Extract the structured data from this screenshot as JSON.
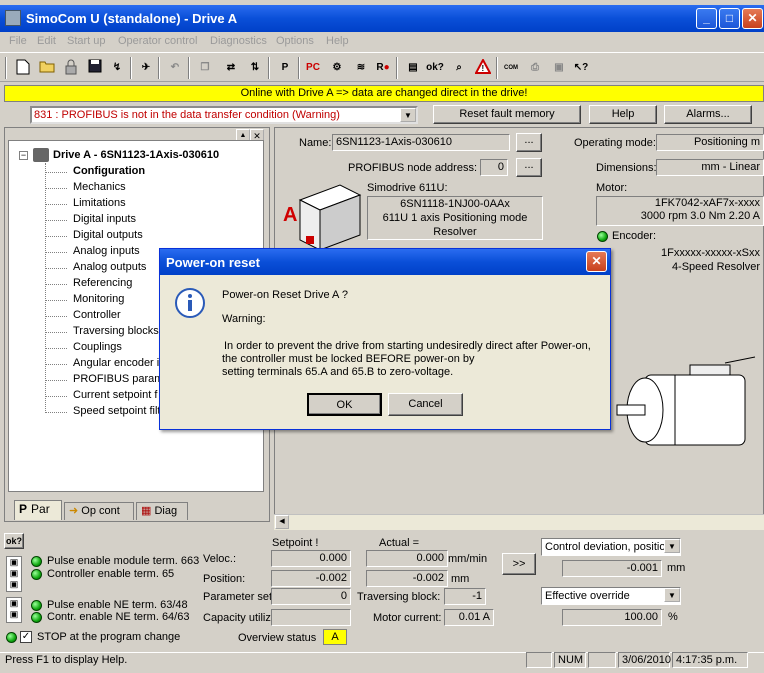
{
  "window": {
    "title": "SimoCom U (standalone) - Drive A",
    "min": "_",
    "max": "□",
    "close": "✕"
  },
  "menu": [
    "File",
    "Edit",
    "Start up",
    "Operator control",
    "Diagnostics",
    "Options",
    "Help"
  ],
  "toolbar": {
    "ok_label": "ok?",
    "pc_label": "PC",
    "p_label": "P",
    "r_label": "R",
    "com_label": "COM"
  },
  "banner": "Online with Drive A => data are changed direct in the drive!",
  "fault": {
    "selected": "831 : PROFIBUS is not in the data transfer condition (Warning)",
    "reset_button": "Reset fault memory",
    "help_button": "Help",
    "alarms_button": "Alarms..."
  },
  "tree": {
    "root": "Drive A - 6SN1123-1Axis-030610",
    "items": [
      "Configuration",
      "Mechanics",
      "Limitations",
      "Digital inputs",
      "Digital outputs",
      "Analog inputs",
      "Analog outputs",
      "Referencing",
      "Monitoring",
      "Controller",
      "Traversing blocks",
      "Couplings",
      "Angular encoder in",
      "PROFIBUS paramet",
      "Current setpoint f",
      "Speed setpoint filt"
    ],
    "selected_index": 0
  },
  "tabs": [
    {
      "label": "Par"
    },
    {
      "label": "Op cont"
    },
    {
      "label": "Diag"
    }
  ],
  "config": {
    "name_label": "Name:",
    "name_value": "6SN1123-1Axis-030610",
    "browse": "...",
    "profibus_label": "PROFIBUS node address:",
    "profibus_value": "0",
    "opmode_label": "Operating mode:",
    "opmode_value": "Positioning m",
    "dimensions_label": "Dimensions:",
    "dimensions_value": "mm - Linear",
    "simodrive_label": "Simodrive 611U:",
    "simodrive_lines": [
      "6SN1118-1NJ00-0AAx",
      "611U 1 axis Positioning mode",
      "Resolver"
    ],
    "drive_letter": "A",
    "motor_label": "Motor:",
    "motor_lines": [
      "1FK7042-xAF7x-xxxx",
      "3000 rpm  3.0 Nm  2.20 A"
    ],
    "encoder_label": "Encoder:",
    "encoder_lines": [
      "1Fxxxxx-xxxxx-xSxx",
      "4-Speed   Resolver"
    ]
  },
  "dialog": {
    "title": "Power-on reset",
    "close": "✕",
    "line1": "Power-on Reset Drive A ?",
    "line2": "Warning:",
    "line3": "In order to prevent the drive from starting undesiredly direct after Power-on,",
    "line4": "the controller must be locked BEFORE power-on by",
    "line5": "setting terminals 65.A and 65.B to zero-voltage.",
    "ok": "OK",
    "cancel": "Cancel"
  },
  "bottom": {
    "ok_btn": "ok?",
    "pulse_module": "Pulse enable module term. 663",
    "controller_enable": "Controller enable term. 65",
    "pulse_ne": "Pulse enable NE term. 63/48",
    "contr_ne": "Contr. enable NE term. 64/63",
    "stop_label": "STOP at the program change",
    "setpoint_header": "Setpoint !",
    "actual_header": "Actual =",
    "veloc_label": "Veloc.:",
    "veloc_set": "0.000",
    "veloc_act": "0.000",
    "veloc_unit": "mm/min",
    "pos_label": "Position:",
    "pos_set": "-0.002",
    "pos_act": "-0.002",
    "pos_unit": "mm",
    "paramset_label": "Parameter set:",
    "paramset_value": "0",
    "trav_label": "Traversing block:",
    "trav_value": "-1",
    "capacity_label": "Capacity utiliz",
    "motorcurr_label": "Motor current:",
    "motorcurr_value": "0.01 A",
    "overview_label": "Overview status",
    "overview_value": "A",
    "more_btn": ">>",
    "ctrl_dev_select": "Control deviation, positio",
    "ctrl_dev_value": "-0.001",
    "ctrl_dev_unit": "mm",
    "override_select": "Effective override",
    "override_value": "100.00",
    "override_unit": "%"
  },
  "status": {
    "help": "Press F1 to display Help.",
    "num": "NUM",
    "date": "3/06/2010",
    "time": "4:17:35 p.m."
  },
  "colors": {
    "banner": "#ffff00",
    "fault_text": "#c00000",
    "led_green": "#22aa22",
    "title_blue": "#0a4fd8"
  }
}
